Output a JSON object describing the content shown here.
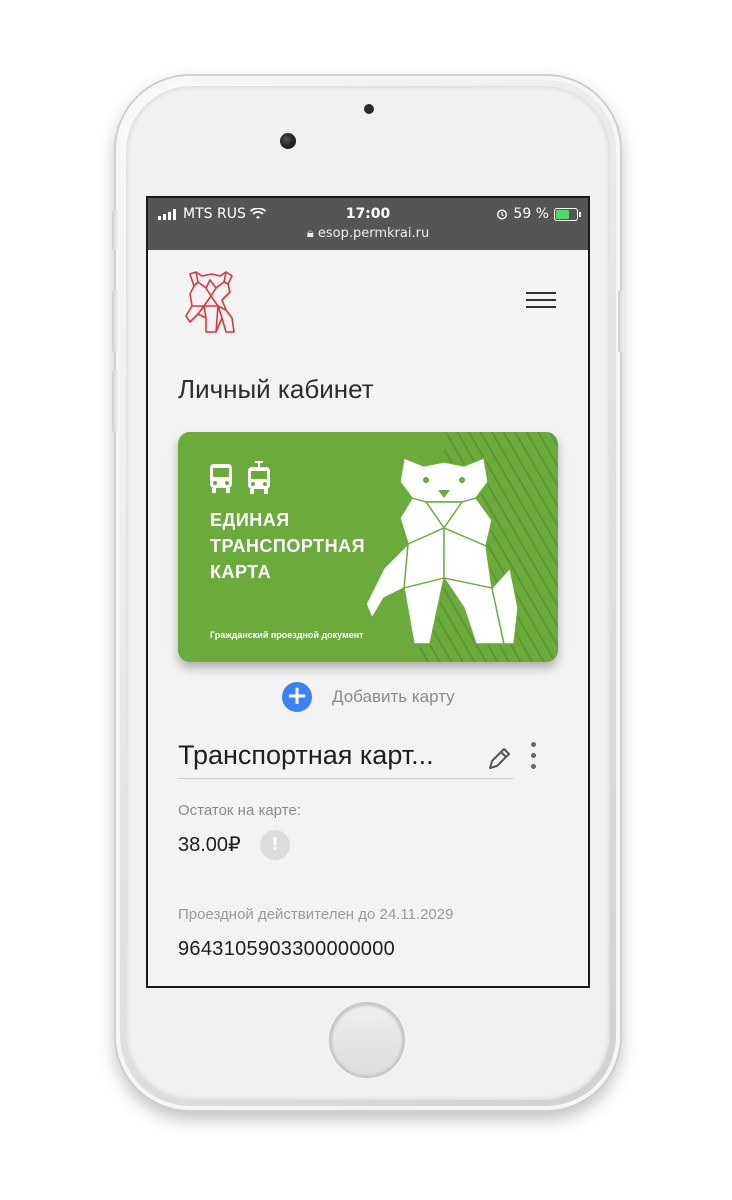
{
  "status_bar": {
    "carrier": "MTS RUS",
    "time": "17:00",
    "battery": "59 %",
    "url": "esop.permkrai.ru"
  },
  "header": {
    "logo_icon": "bear-logo-icon",
    "menu_icon": "hamburger-menu-icon"
  },
  "page": {
    "title": "Личный кабинет"
  },
  "card": {
    "line1": "ЕДИНАЯ",
    "line2": "ТРАНСПОРТНАЯ",
    "line3": "КАРТА",
    "subtitle": "Гражданский проездной документ",
    "color": "#6aab3c"
  },
  "add_card": {
    "label": "Добавить карту",
    "icon": "+"
  },
  "card_details": {
    "name": "Транспортная карт...",
    "balance_label": "Остаток на карте:",
    "balance": "38.00₽",
    "info_icon": "!",
    "valid_until": "Проездной действителен до 24.11.2029",
    "number": "9643105903300000000"
  },
  "colors": {
    "accent": "#3b82f6",
    "logo": "#d9363e",
    "card_green": "#6aab3c"
  }
}
